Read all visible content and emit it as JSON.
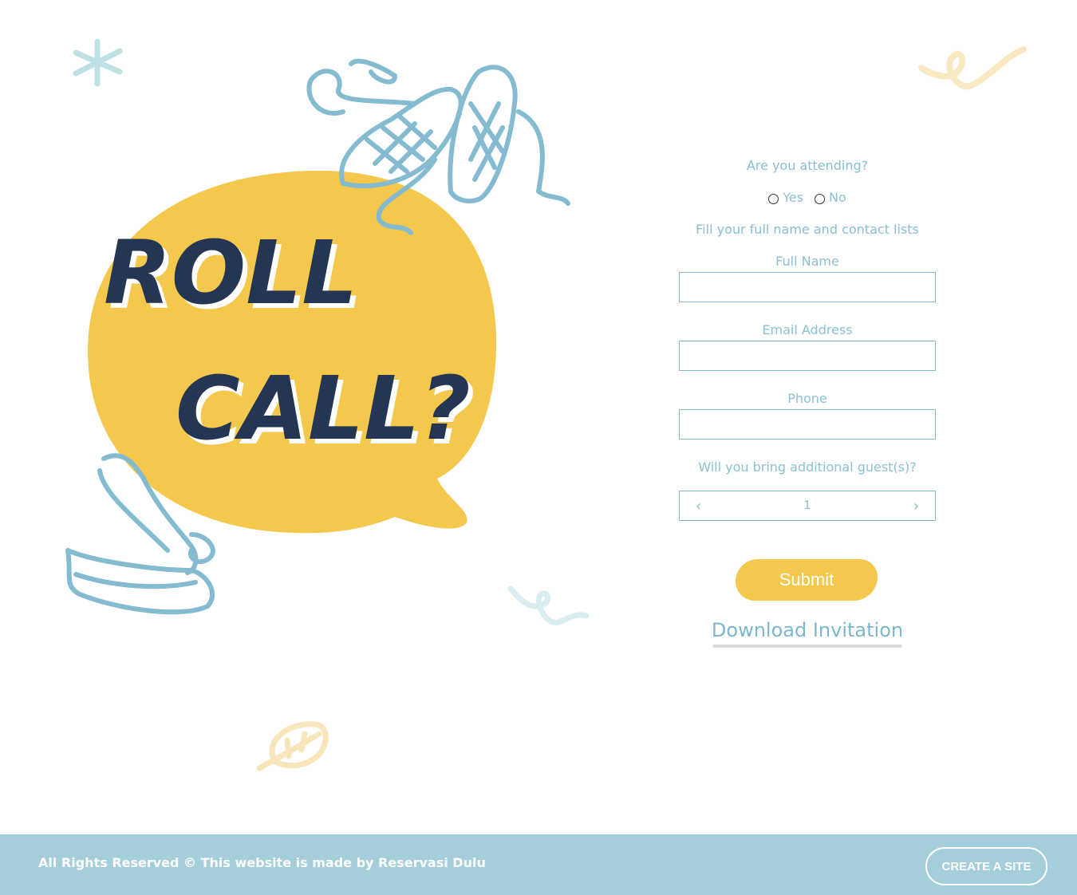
{
  "hero": {
    "title_line1": "ROLL",
    "title_line2": "CALL?"
  },
  "form": {
    "attending_question": "Are you attending?",
    "options": [
      {
        "label": "Yes",
        "selected": false
      },
      {
        "label": "No",
        "selected": false
      }
    ],
    "instruction": "Fill your full name and contact lists",
    "full_name_label": "Full Name",
    "email_label": "Email Address",
    "phone_label": "Phone",
    "guests_question": "Will you bring additional guest(s)?",
    "guests_value": "1",
    "submit_label": "Submit",
    "download_label": "Download Invitation"
  },
  "footer": {
    "text": "All Rights Reserved © This website is made by Reservasi Dulu",
    "create_button": "CREATE A SITE"
  },
  "colors": {
    "accent_yellow": "#f3c84c",
    "accent_blue": "#86bfd1",
    "title_navy": "#243653",
    "footer_bg": "#a4ced9"
  }
}
